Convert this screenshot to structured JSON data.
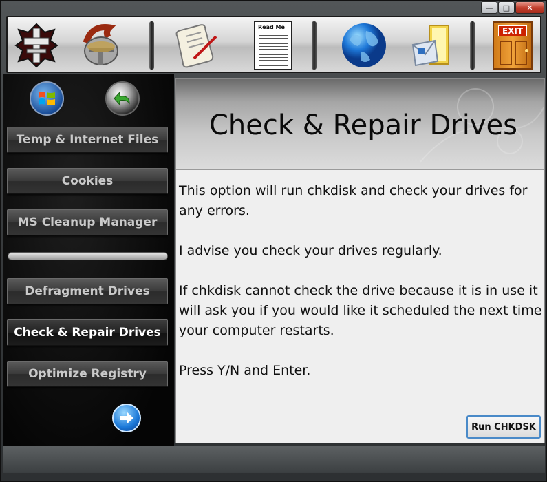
{
  "window": {
    "controls": {
      "minimize": "—",
      "maximize": "□",
      "close": "✕"
    }
  },
  "toolbar": {
    "icons": [
      "cross-emblem-icon",
      "warrior-helmet-icon",
      "scroll-quill-icon",
      "readme-document-icon",
      "globe-icon",
      "email-icon",
      "exit-door-icon"
    ],
    "readme_label": "Read Me",
    "exit_label": "EXIT"
  },
  "sidebar": {
    "items": [
      {
        "label": "Temp & Internet Files"
      },
      {
        "label": "Cookies"
      },
      {
        "label": "MS Cleanup Manager"
      },
      {
        "label": "Defragment Drives"
      },
      {
        "label": "Check & Repair Drives"
      },
      {
        "label": "Optimize Registry"
      }
    ],
    "active_index": 4
  },
  "content": {
    "title": "Check & Repair Drives",
    "paragraphs": [
      "This option will run chkdisk and check your drives for any errors.",
      "I advise you check your drives regularly.",
      "If chkdisk cannot check the drive because it is in use it will ask you if you would like it scheduled the next time your computer restarts.",
      "Press Y/N and Enter."
    ],
    "run_button": "Run CHKDSK"
  },
  "colors": {
    "accent_blue": "#2a7fd4",
    "exit_red": "#cc2200",
    "panel_bg": "#efefef"
  }
}
